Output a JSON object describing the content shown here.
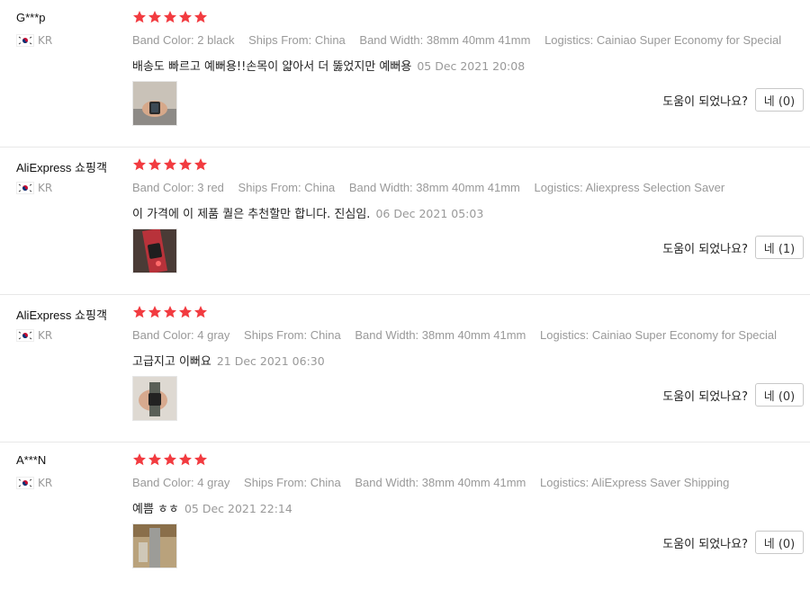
{
  "colors": {
    "star": "#f23b40",
    "muted": "#999999"
  },
  "labels": {
    "band_color": "Band Color:",
    "ships_from": "Ships From:",
    "band_width": "Band Width:",
    "logistics": "Logistics:"
  },
  "helpful_question": "도움이 되었나요?",
  "reviews": [
    {
      "user": "G***p",
      "country": "KR",
      "rating": 5,
      "band_color": "2 black",
      "ships_from": "China",
      "band_width": "38mm 40mm 41mm",
      "logistics": "Cainiao Super Economy for Special",
      "text": "배송도 빠르고 예뻐용!!손목이 얇아서 더 뚫었지만 예뻐용",
      "date": "05 Dec 2021 20:08",
      "helpful_btn": "네 (0)"
    },
    {
      "user": "AliExpress 쇼핑객",
      "country": "KR",
      "rating": 5,
      "band_color": "3 red",
      "ships_from": "China",
      "band_width": "38mm 40mm 41mm",
      "logistics": "Aliexpress Selection Saver",
      "text": "이 가격에 이 제품 퀄은 추천할만 합니다. 진심임.",
      "date": "06 Dec 2021 05:03",
      "helpful_btn": "네 (1)"
    },
    {
      "user": "AliExpress 쇼핑객",
      "country": "KR",
      "rating": 5,
      "band_color": "4 gray",
      "ships_from": "China",
      "band_width": "38mm 40mm 41mm",
      "logistics": "Cainiao Super Economy for Special",
      "text": "고급지고 이뻐요",
      "date": "21 Dec 2021 06:30",
      "helpful_btn": "네 (0)"
    },
    {
      "user": "A***N",
      "country": "KR",
      "rating": 5,
      "band_color": "4 gray",
      "ships_from": "China",
      "band_width": "38mm 40mm 41mm",
      "logistics": "AliExpress Saver Shipping",
      "text": "예쁨 ㅎㅎ",
      "date": "05 Dec 2021 22:14",
      "helpful_btn": "네 (0)"
    }
  ]
}
